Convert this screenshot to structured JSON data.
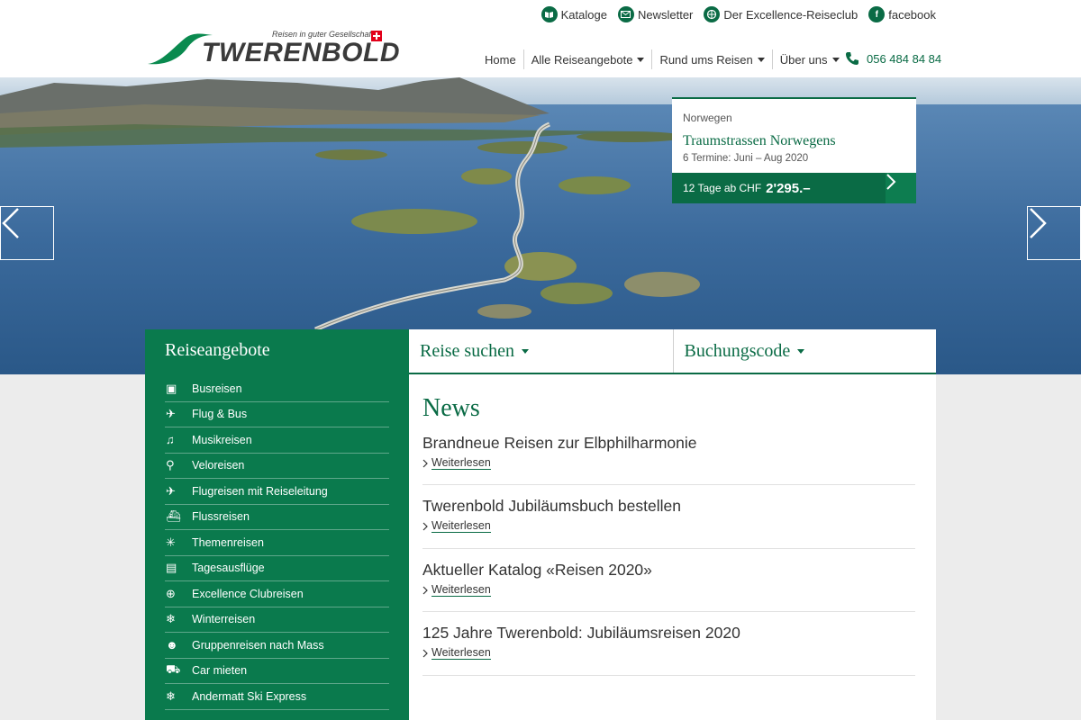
{
  "header": {
    "logo_tagline": "Reisen in guter Gesellschaft",
    "logo_text": "TWERENBOLD",
    "utility_links": [
      {
        "label": "Kataloge",
        "icon": "book-icon"
      },
      {
        "label": "Newsletter",
        "icon": "envelope-icon"
      },
      {
        "label": "Der Excellence-Reiseclub",
        "icon": "club-icon"
      },
      {
        "label": "facebook",
        "icon": "facebook-icon"
      }
    ],
    "nav": [
      {
        "label": "Home",
        "dropdown": false
      },
      {
        "label": "Alle Reiseangebote",
        "dropdown": true
      },
      {
        "label": "Rund ums Reisen",
        "dropdown": true
      },
      {
        "label": "Über uns",
        "dropdown": true
      }
    ],
    "phone": "056 484 84 84"
  },
  "hero_teaser": {
    "region": "Norwegen",
    "title": "Traumstrassen Norwegens",
    "dates": "6 Termine: Juni – Aug 2020",
    "price_prefix": "12 Tage ab CHF",
    "price": "2'295.–"
  },
  "sidebar": {
    "title": "Reiseangebote",
    "items": [
      {
        "label": "Busreisen",
        "icon": "bus-icon"
      },
      {
        "label": "Flug & Bus",
        "icon": "plane-bus-icon"
      },
      {
        "label": "Musikreisen",
        "icon": "music-icon"
      },
      {
        "label": "Veloreisen",
        "icon": "bicycle-icon"
      },
      {
        "label": "Flugreisen mit Reiseleitung",
        "icon": "plane-icon"
      },
      {
        "label": "Flussreisen",
        "icon": "ship-icon"
      },
      {
        "label": "Themenreisen",
        "icon": "sparkle-icon"
      },
      {
        "label": "Tagesausflüge",
        "icon": "ticket-icon"
      },
      {
        "label": "Excellence Clubreisen",
        "icon": "club-icon"
      },
      {
        "label": "Winterreisen",
        "icon": "snowflake-icon"
      },
      {
        "label": "Gruppenreisen nach Mass",
        "icon": "group-icon"
      },
      {
        "label": "Car mieten",
        "icon": "car-icon"
      },
      {
        "label": "Andermatt Ski Express",
        "icon": "snowflake-icon"
      }
    ]
  },
  "tabs": [
    {
      "label": "Reise suchen"
    },
    {
      "label": "Buchungscode"
    }
  ],
  "news": {
    "heading": "News",
    "items": [
      {
        "title": "Brandneue Reisen zur Elbphilharmonie",
        "link": "Weiterlesen"
      },
      {
        "title": "Twerenbold Jubiläumsbuch bestellen",
        "link": "Weiterlesen"
      },
      {
        "title": "Aktueller Katalog «Reisen 2020»",
        "link": "Weiterlesen"
      },
      {
        "title": "125 Jahre Twerenbold: Jubiläumsreisen 2020",
        "link": "Weiterlesen"
      }
    ]
  },
  "colors": {
    "brand_green": "#0a6b45",
    "sidebar_green": "#0a7a4d"
  }
}
